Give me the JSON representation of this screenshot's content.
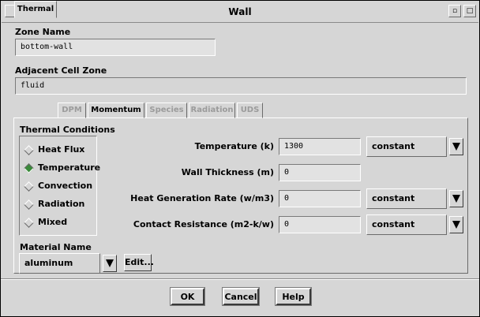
{
  "window": {
    "title": "Wall",
    "minimize_glyph": "▫",
    "maximize_glyph": "□"
  },
  "zone_name": {
    "label": "Zone Name",
    "value": "bottom-wall"
  },
  "adjacent_cell_zone": {
    "label": "Adjacent Cell Zone",
    "value": "fluid"
  },
  "tabs": [
    {
      "label": "Thermal",
      "active": true
    },
    {
      "label": "DPM",
      "active": false
    },
    {
      "label": "Momentum",
      "active": true
    },
    {
      "label": "Species",
      "active": false
    },
    {
      "label": "Radiation",
      "active": false
    },
    {
      "label": "UDS",
      "active": false
    }
  ],
  "thermal_conditions": {
    "label": "Thermal Conditions",
    "options": [
      "Heat Flux",
      "Temperature",
      "Convection",
      "Radiation",
      "Mixed"
    ],
    "selected": "Temperature"
  },
  "parameters": {
    "temperature": {
      "label": "Temperature (k)",
      "value": "1300",
      "method": "constant"
    },
    "wall_thickness": {
      "label": "Wall Thickness (m)",
      "value": "0"
    },
    "heat_generation": {
      "label": "Heat Generation Rate (w/m3)",
      "value": "0",
      "method": "constant"
    },
    "contact_resistance": {
      "label": "Contact Resistance (m2-k/w)",
      "value": "0",
      "method": "constant"
    }
  },
  "material": {
    "label": "Material Name",
    "value": "aluminum",
    "edit_label": "Edit..."
  },
  "buttons": {
    "ok": "OK",
    "cancel": "Cancel",
    "help": "Help"
  },
  "colors": {
    "background": "#d6d6d6",
    "selected_radio": "#3a8a3a"
  }
}
